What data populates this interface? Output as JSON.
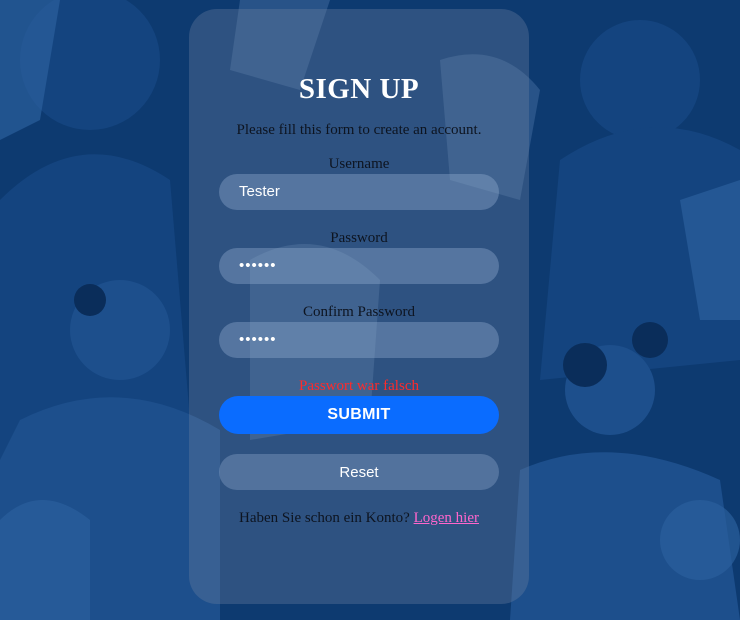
{
  "form": {
    "title": "SIGN UP",
    "subtitle": "Please fill this form to create an account.",
    "username_label": "Username",
    "username_value": "Tester",
    "password_label": "Password",
    "password_value": "••••••",
    "confirm_label": "Confirm Password",
    "confirm_value": "••••••",
    "error_message": "Passwort war falsch",
    "submit_label": "SUBMIT",
    "reset_label": "Reset",
    "footer_text": "Haben Sie schon ein Konto?",
    "login_link": "Logen hier"
  },
  "colors": {
    "background": "#1f3a66",
    "accent": "#0a6cff",
    "error": "#ff2a2a",
    "link": "#ff66cc"
  }
}
